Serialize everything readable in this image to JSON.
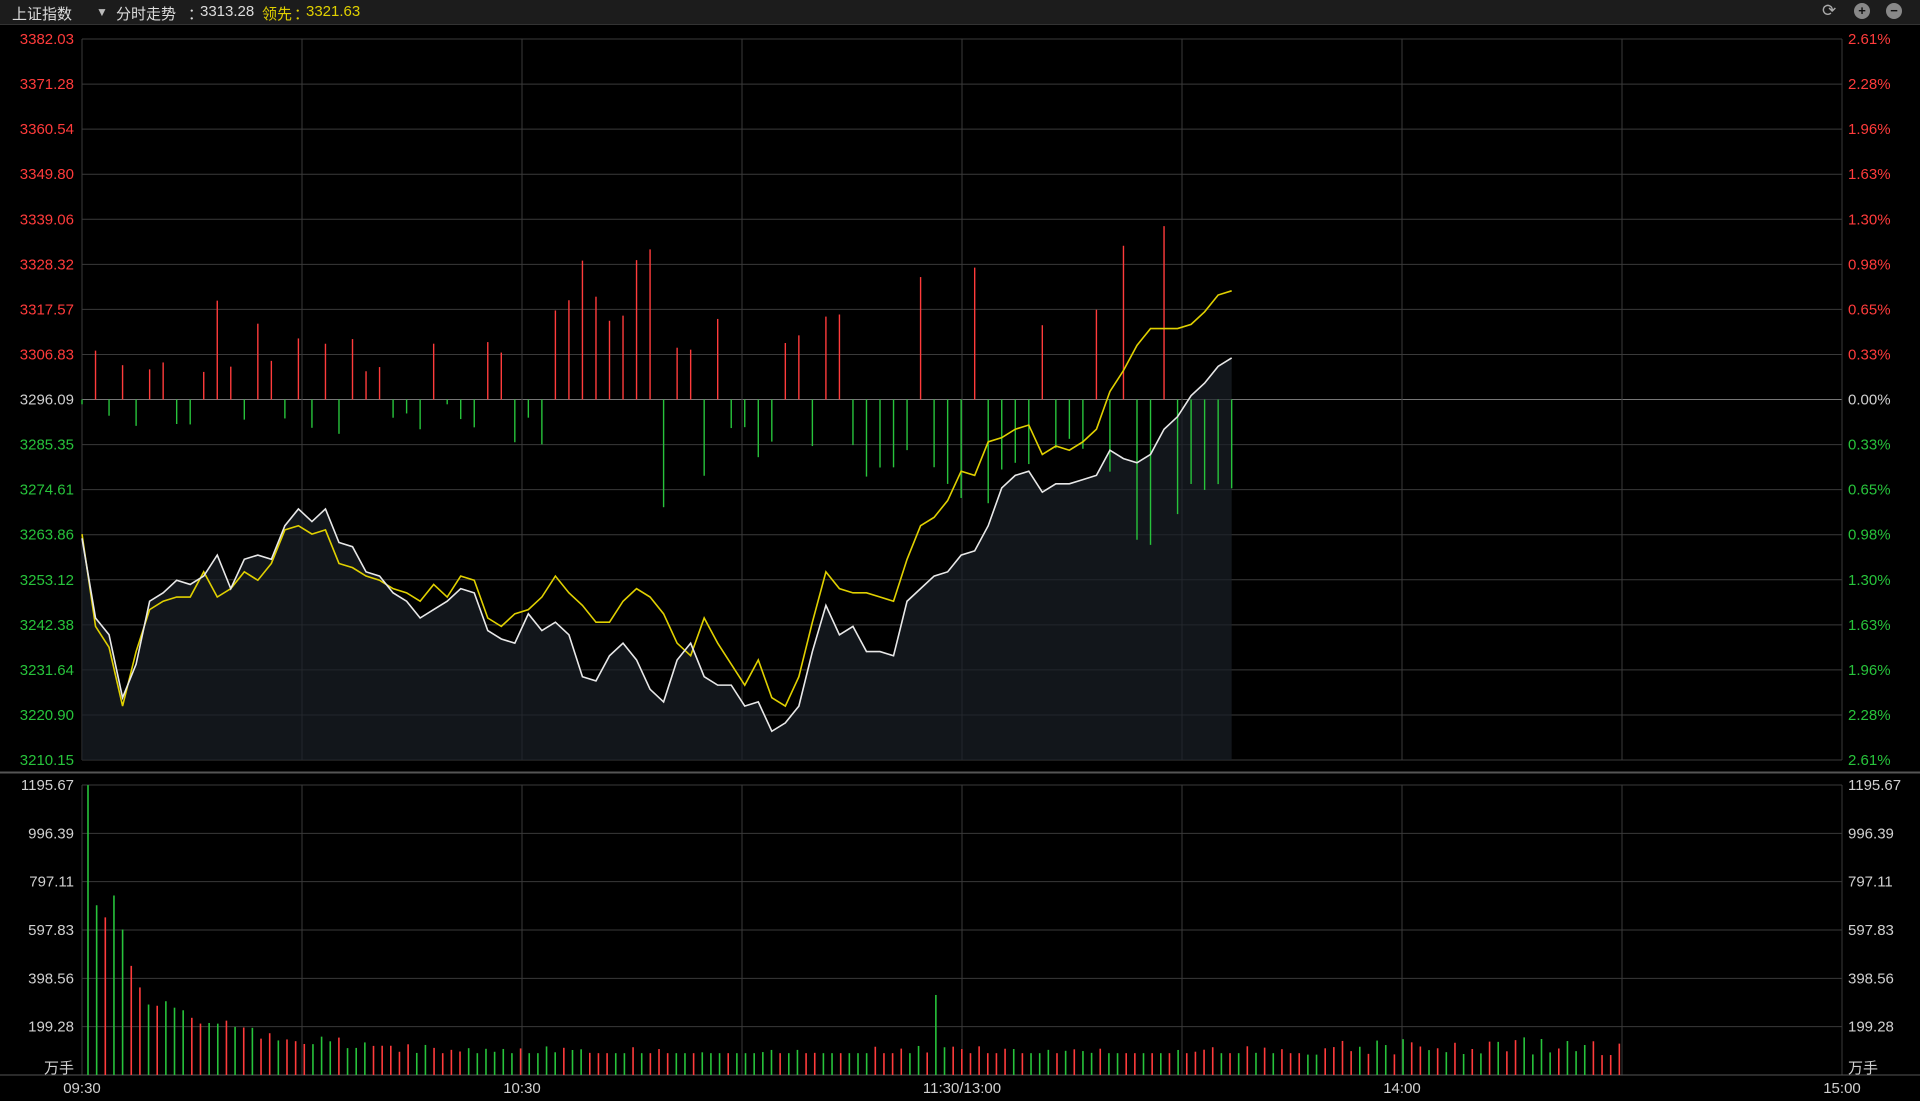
{
  "header": {
    "index_name": "上证指数",
    "mode_label": "分时走势",
    "mode_value": "3313.28",
    "lead_label": "领先",
    "lead_value": "3321.63",
    "refresh_icon": "refresh-icon",
    "zoom_in_icon": "plus-circle-icon",
    "zoom_out_icon": "minus-circle-icon"
  },
  "colors": {
    "background": "#000000",
    "up": "#ff3b3b",
    "down": "#27c33b",
    "index_line": "#e8e8e8",
    "lead_line": "#e0d000",
    "grid": "#3a3a3a"
  },
  "chart_data": [
    {
      "type": "line",
      "title": "",
      "x_ticks": [
        "09:30",
        "10:30",
        "11:30/13:00",
        "14:00",
        "15:00"
      ],
      "y_ticks_left": [
        "3382.03",
        "3371.28",
        "3360.54",
        "3349.80",
        "3339.06",
        "3328.32",
        "3317.57",
        "3306.83",
        "3296.09",
        "3285.35",
        "3274.61",
        "3263.86",
        "3253.12",
        "3242.38",
        "3231.64",
        "3220.90",
        "3210.15"
      ],
      "y_ticks_right": [
        "2.61%",
        "2.28%",
        "1.96%",
        "1.63%",
        "1.30%",
        "0.98%",
        "0.65%",
        "0.33%",
        "0.00%",
        "0.33%",
        "0.65%",
        "0.98%",
        "1.30%",
        "1.63%",
        "1.96%",
        "2.28%",
        "2.61%"
      ],
      "ylim": [
        3210.15,
        3382.03
      ],
      "base_value": 3296.09,
      "series": [
        {
          "name": "分时走势",
          "color": "#e8e8e8",
          "minute_index": [
            0,
            2,
            4,
            6,
            8,
            10,
            12,
            14,
            16,
            18,
            20,
            22,
            24,
            26,
            28,
            30,
            32,
            34,
            36,
            38,
            40,
            42,
            44,
            46,
            48,
            50,
            52,
            54,
            56,
            58,
            60,
            62,
            64,
            66,
            68,
            70,
            72,
            74,
            76,
            78,
            80,
            82,
            84,
            86,
            88,
            90,
            92,
            94,
            96,
            98,
            100,
            102,
            104,
            106,
            108,
            110,
            112,
            114,
            116,
            118,
            120,
            122,
            124,
            126,
            128,
            130,
            132,
            134,
            136,
            138,
            140,
            142,
            144,
            146,
            148,
            150,
            152,
            154,
            156,
            158,
            160,
            162,
            164,
            166,
            168,
            170,
            172,
            174,
            176,
            178,
            180,
            182,
            184,
            186,
            188,
            190,
            192,
            194,
            196,
            198,
            200,
            202,
            204,
            206,
            208
          ],
          "values": [
            3263,
            3244,
            3240,
            3225,
            3233,
            3248,
            3250,
            3253,
            3252,
            3254,
            3259,
            3251,
            3258,
            3259,
            3258,
            3266,
            3270,
            3267,
            3270,
            3262,
            3261,
            3255,
            3254,
            3250,
            3248,
            3244,
            3246,
            3248,
            3251,
            3250,
            3241,
            3239,
            3238,
            3245,
            3241,
            3243,
            3240,
            3230,
            3229,
            3235,
            3238,
            3234,
            3227,
            3224,
            3234,
            3238,
            3230,
            3228,
            3228,
            3223,
            3224,
            3217,
            3219,
            3223,
            3236,
            3247,
            3240,
            3242,
            3236,
            3236,
            3235,
            3248,
            3251,
            3254,
            3255,
            3259,
            3260,
            3266,
            3275,
            3278,
            3279,
            3274,
            3276,
            3276,
            3277,
            3278,
            3284,
            3282,
            3281,
            3283,
            3289,
            3292,
            3297,
            3300,
            3304,
            3306
          ],
          "note": ""
        },
        {
          "name": "领先",
          "color": "#e0d000",
          "values": [
            3264,
            3242,
            3237,
            3223,
            3236,
            3246,
            3248,
            3249,
            3249,
            3255,
            3249,
            3251,
            3255,
            3253,
            3257,
            3265,
            3266,
            3264,
            3265,
            3257,
            3256,
            3254,
            3253,
            3251,
            3250,
            3248,
            3252,
            3249,
            3254,
            3253,
            3244,
            3242,
            3245,
            3246,
            3249,
            3254,
            3250,
            3247,
            3243,
            3243,
            3248,
            3251,
            3249,
            3245,
            3238,
            3235,
            3244,
            3238,
            3233,
            3228,
            3234,
            3225,
            3223,
            3230,
            3243,
            3255,
            3251,
            3250,
            3250,
            3249,
            3248,
            3258,
            3266,
            3268,
            3272,
            3279,
            3278,
            3286,
            3287,
            3289,
            3290,
            3283,
            3285,
            3284,
            3286,
            3289,
            3298,
            3303,
            3309,
            3313,
            3313,
            3313,
            3314,
            3317,
            3321,
            3322
          ]
        }
      ]
    },
    {
      "type": "bar",
      "title": "",
      "unit_label": "万手",
      "y_ticks": [
        "1195.67",
        "996.39",
        "797.11",
        "597.83",
        "398.56",
        "199.28"
      ],
      "ylim": [
        0,
        1195.67
      ],
      "x_ticks": [
        "09:30",
        "10:30",
        "11:30/13:00",
        "14:00",
        "15:00"
      ],
      "note": "volume per minute, colored red (up) / green (down)"
    }
  ]
}
